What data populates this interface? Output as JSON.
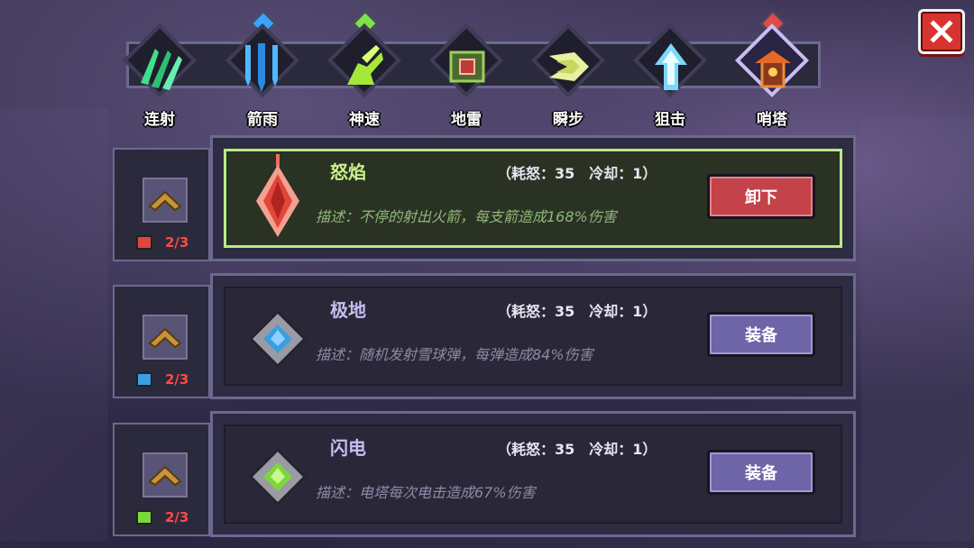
{
  "close_icon": "close-icon",
  "tabs": [
    {
      "label": "连射",
      "icon": "green-claw-icon",
      "gem_color": "#6f6c80"
    },
    {
      "label": "箭雨",
      "icon": "blue-arrow-rain-icon",
      "gem_color": "#3aa4ff"
    },
    {
      "label": "神速",
      "icon": "green-wing-boot-icon",
      "gem_color": "#7fe04a"
    },
    {
      "label": "地雷",
      "icon": "green-mine-icon",
      "gem_color": "#6f6c80"
    },
    {
      "label": "瞬步",
      "icon": "yellow-dash-icon",
      "gem_color": "#6f6c80"
    },
    {
      "label": "狙击",
      "icon": "blue-arrow-icon",
      "gem_color": "#6f6c80"
    },
    {
      "label": "哨塔",
      "icon": "orange-turret-icon",
      "gem_color": "#e24a4a",
      "active": true
    }
  ],
  "skills": [
    {
      "name": "怒焰",
      "cost": "（耗怒：35　冷却：1）",
      "desc": "描述：不停的射出火箭，每支箭造成168%伤害",
      "level": "2/3",
      "button": "卸下",
      "equipped": true,
      "gem_color": "#e0463a",
      "level_icon": "red-chest-icon"
    },
    {
      "name": "极地",
      "cost": "（耗怒：35　冷却：1）",
      "desc": "描述：随机发射雪球弹，每弹造成84%伤害",
      "level": "2/3",
      "button": "装备",
      "equipped": false,
      "gem_color": "#3a9ee0",
      "level_icon": "blue-chest-icon"
    },
    {
      "name": "闪电",
      "cost": "（耗怒：35　冷却：1）",
      "desc": "描述：电塔每次电击造成67%伤害",
      "level": "2/3",
      "button": "装备",
      "equipped": false,
      "gem_color": "#7cd83a",
      "level_icon": "green-chest-icon"
    }
  ]
}
